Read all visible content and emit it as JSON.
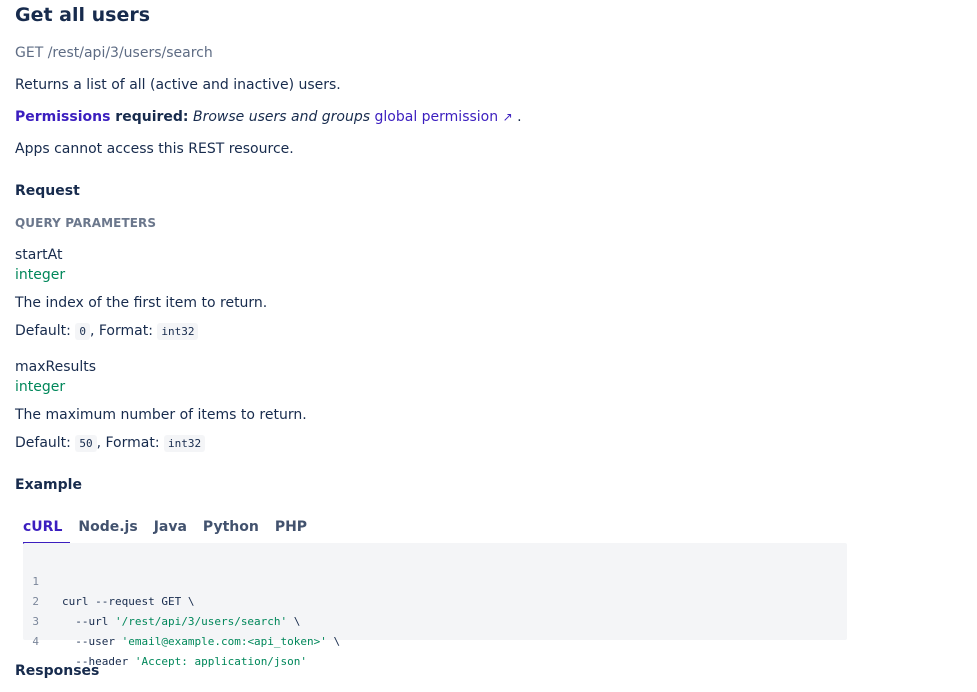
{
  "header": {
    "title": "Get all users",
    "method": "GET",
    "path": "/rest/api/3/users/search",
    "description": "Returns a list of all (active and inactive) users."
  },
  "permissions": {
    "label_link": "Permissions",
    "label_rest": " required:",
    "text_italic": "Browse users and groups",
    "link": "global permission",
    "ext_icon": "↗",
    "end": "."
  },
  "apps_note": "Apps cannot access this REST resource.",
  "request": {
    "heading": "Request",
    "query_heading": "QUERY PARAMETERS",
    "params": [
      {
        "name": "startAt",
        "type": "integer",
        "description": "The index of the first item to return.",
        "default_label": "Default:",
        "default": "0",
        "format_label": ", Format:",
        "format": "int32"
      },
      {
        "name": "maxResults",
        "type": "integer",
        "description": "The maximum number of items to return.",
        "default_label": "Default:",
        "default": "50",
        "format_label": ", Format:",
        "format": "int32"
      }
    ]
  },
  "example": {
    "heading": "Example",
    "tabs": [
      {
        "label": "cURL",
        "active": true
      },
      {
        "label": "Node.js",
        "active": false
      },
      {
        "label": "Java",
        "active": false
      },
      {
        "label": "Python",
        "active": false
      },
      {
        "label": "PHP",
        "active": false
      }
    ],
    "code_lines": [
      {
        "num": "1",
        "text": "curl --request GET \\",
        "str": "",
        "tail": ""
      },
      {
        "num": "2",
        "text": "  --url ",
        "str": "'/rest/api/3/users/search'",
        "tail": " \\"
      },
      {
        "num": "3",
        "text": "  --user ",
        "str": "'email@example.com:<api_token>'",
        "tail": " \\"
      },
      {
        "num": "4",
        "text": "  --header ",
        "str": "'Accept: application/json'",
        "tail": ""
      }
    ]
  },
  "responses": {
    "heading": "Responses"
  },
  "colors": {
    "link": "#3b1ebf",
    "type": "#00875a",
    "muted": "#5e6c84"
  }
}
